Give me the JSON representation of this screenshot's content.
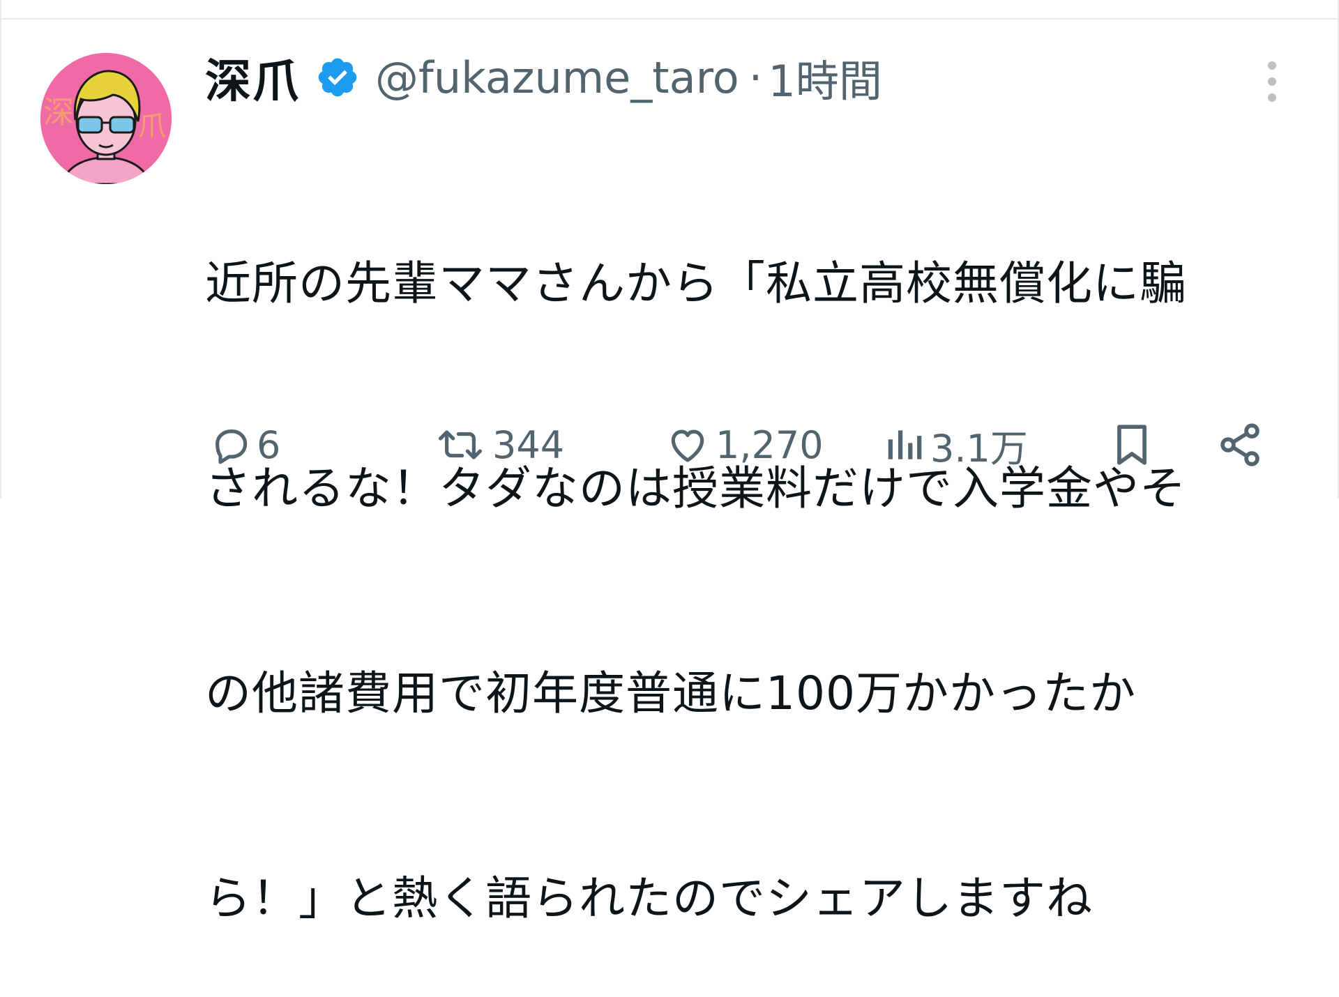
{
  "tweet": {
    "display_name": "深爪",
    "handle": "@fukazume_taro",
    "separator": "·",
    "time": "1時間",
    "text_lines": [
      "近所の先輩ママさんから「私立高校無償化に騙",
      "されるな！タダなのは授業料だけで入学金やそ",
      "の他諸費用で初年度普通に100万かかったか",
      "ら！」と熱く語られたのでシェアしますね"
    ],
    "avatar_text": "深爪"
  },
  "actions": {
    "replies": "6",
    "retweets": "344",
    "likes": "1,270",
    "views": "3.1万"
  },
  "icons": {
    "verified": "verified-badge-icon",
    "more": "more-vertical-icon",
    "reply": "reply-icon",
    "retweet": "retweet-icon",
    "like": "heart-icon",
    "views": "views-icon",
    "bookmark": "bookmark-icon",
    "share": "share-icon"
  },
  "colors": {
    "text": "#0f1419",
    "secondary": "#536471",
    "verified": "#1d9bf0",
    "avatar_bg": "#f06aa8",
    "border": "#e6eaec"
  }
}
